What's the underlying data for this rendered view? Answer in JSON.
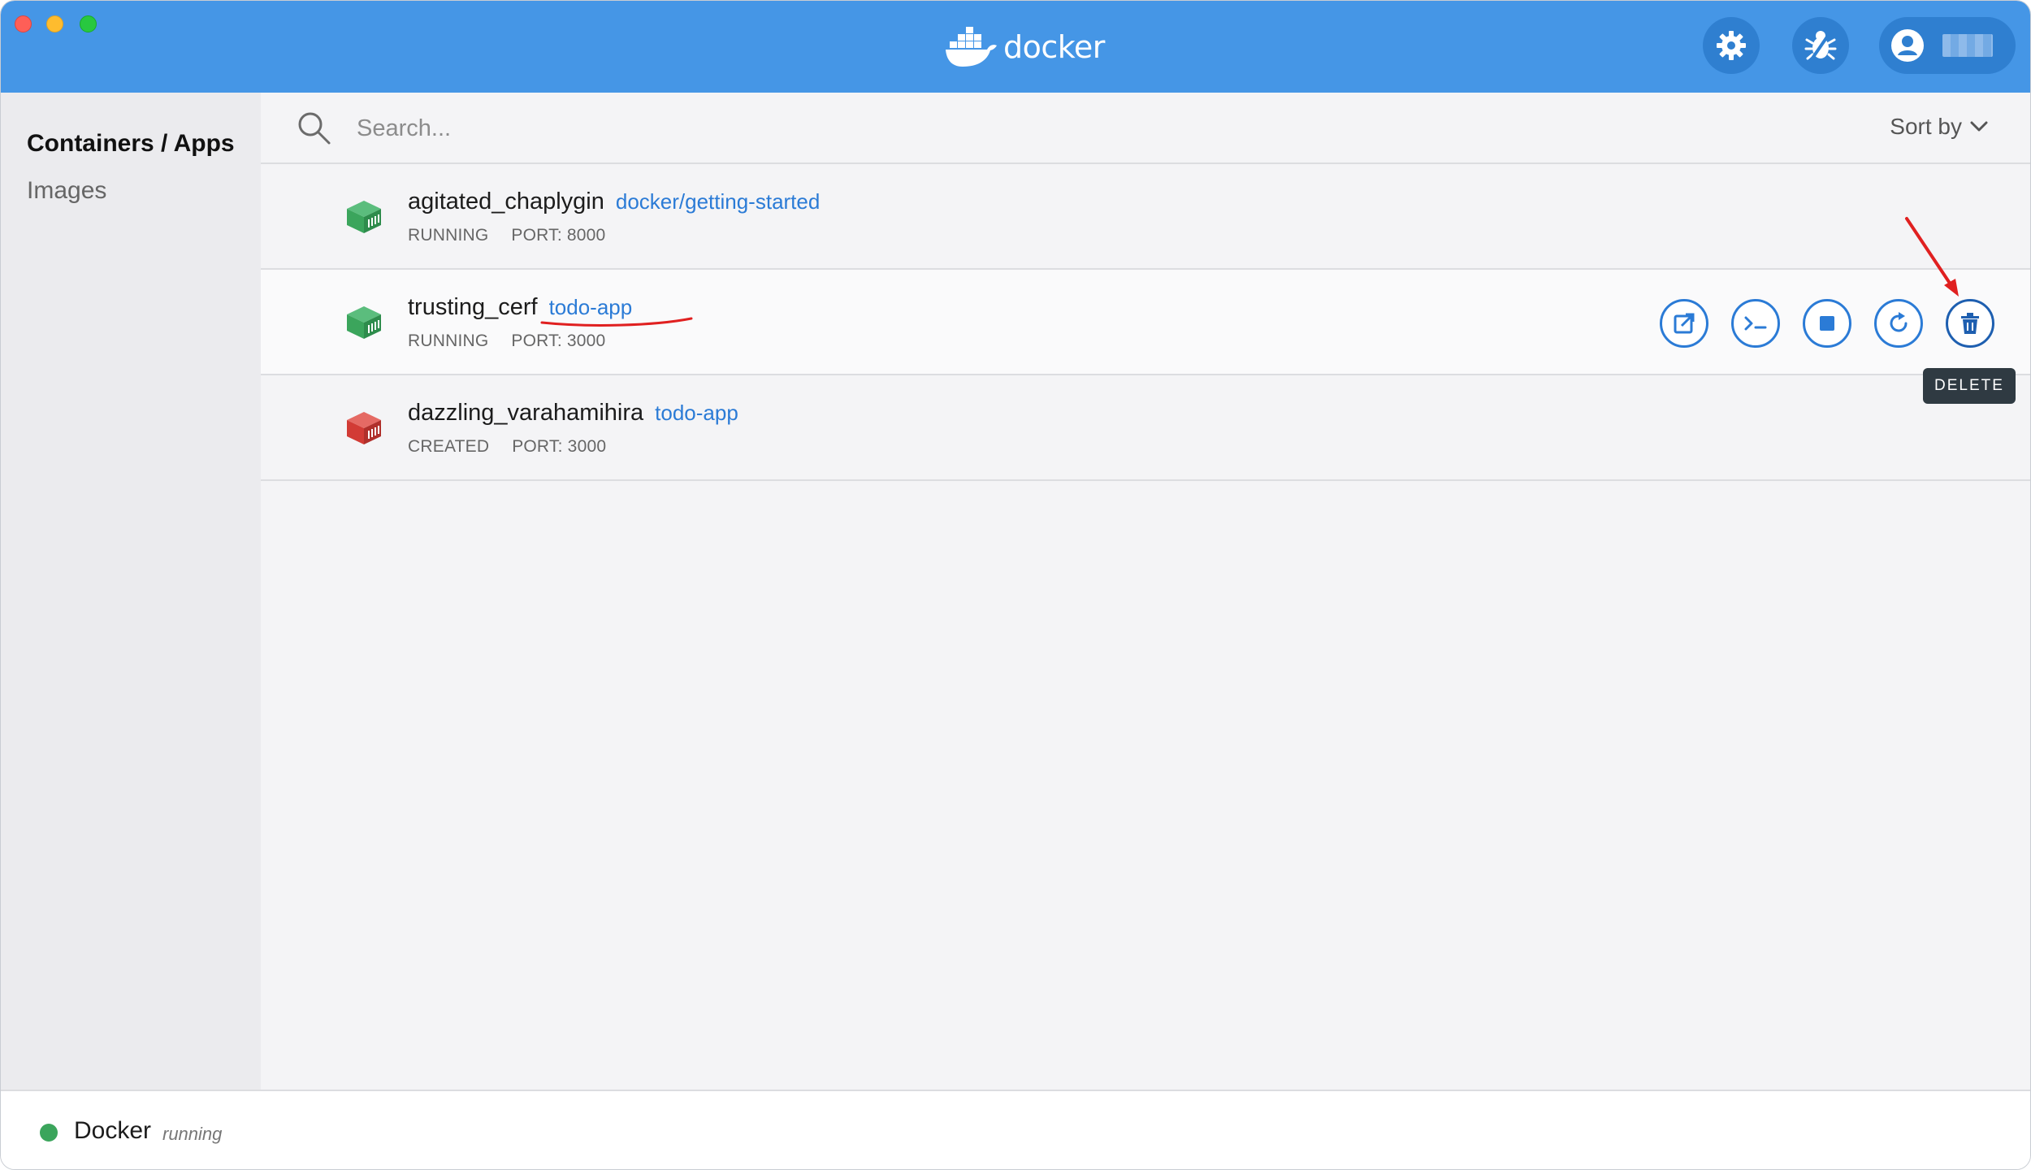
{
  "window": {
    "logo_text": "docker",
    "colors": {
      "titlebar": "#4596e6",
      "running": "#3ba55c",
      "created": "#d23b35",
      "accent": "#2b7bd6"
    }
  },
  "header": {
    "settings_icon": "gear-icon",
    "troubleshoot_icon": "bug-icon",
    "account_icon": "user-icon"
  },
  "sidebar": {
    "items": [
      {
        "label": "Containers / Apps",
        "active": true
      },
      {
        "label": "Images",
        "active": false
      }
    ]
  },
  "search": {
    "placeholder": "Search...",
    "value": ""
  },
  "sort": {
    "label": "Sort by"
  },
  "containers": [
    {
      "name": "agitated_chaplygin",
      "image": "docker/getting-started",
      "status": "RUNNING",
      "port": "PORT: 8000"
    },
    {
      "name": "trusting_cerf",
      "image": "todo-app",
      "status": "RUNNING",
      "port": "PORT: 3000"
    },
    {
      "name": "dazzling_varahamihira",
      "image": "todo-app",
      "status": "CREATED",
      "port": "PORT: 3000"
    }
  ],
  "row_actions": {
    "open_browser": "open-in-browser-icon",
    "cli": "cli-icon",
    "stop": "stop-icon",
    "restart": "restart-icon",
    "delete": "trash-icon"
  },
  "tooltip": {
    "text": "DELETE"
  },
  "footer": {
    "label": "Docker",
    "state": "running"
  }
}
